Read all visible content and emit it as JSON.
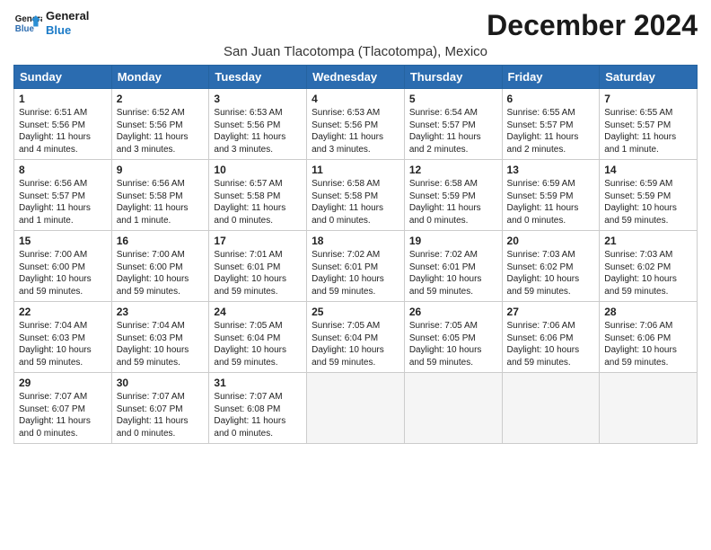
{
  "logo": {
    "line1": "General",
    "line2": "Blue"
  },
  "title": "December 2024",
  "subtitle": "San Juan Tlacotompa (Tlacotompa), Mexico",
  "days_header": [
    "Sunday",
    "Monday",
    "Tuesday",
    "Wednesday",
    "Thursday",
    "Friday",
    "Saturday"
  ],
  "weeks": [
    [
      {
        "day": "1",
        "sunrise": "6:51 AM",
        "sunset": "5:56 PM",
        "daylight": "11 hours and 4 minutes."
      },
      {
        "day": "2",
        "sunrise": "6:52 AM",
        "sunset": "5:56 PM",
        "daylight": "11 hours and 3 minutes."
      },
      {
        "day": "3",
        "sunrise": "6:53 AM",
        "sunset": "5:56 PM",
        "daylight": "11 hours and 3 minutes."
      },
      {
        "day": "4",
        "sunrise": "6:53 AM",
        "sunset": "5:56 PM",
        "daylight": "11 hours and 3 minutes."
      },
      {
        "day": "5",
        "sunrise": "6:54 AM",
        "sunset": "5:57 PM",
        "daylight": "11 hours and 2 minutes."
      },
      {
        "day": "6",
        "sunrise": "6:55 AM",
        "sunset": "5:57 PM",
        "daylight": "11 hours and 2 minutes."
      },
      {
        "day": "7",
        "sunrise": "6:55 AM",
        "sunset": "5:57 PM",
        "daylight": "11 hours and 1 minute."
      }
    ],
    [
      {
        "day": "8",
        "sunrise": "6:56 AM",
        "sunset": "5:57 PM",
        "daylight": "11 hours and 1 minute."
      },
      {
        "day": "9",
        "sunrise": "6:56 AM",
        "sunset": "5:58 PM",
        "daylight": "11 hours and 1 minute."
      },
      {
        "day": "10",
        "sunrise": "6:57 AM",
        "sunset": "5:58 PM",
        "daylight": "11 hours and 0 minutes."
      },
      {
        "day": "11",
        "sunrise": "6:58 AM",
        "sunset": "5:58 PM",
        "daylight": "11 hours and 0 minutes."
      },
      {
        "day": "12",
        "sunrise": "6:58 AM",
        "sunset": "5:59 PM",
        "daylight": "11 hours and 0 minutes."
      },
      {
        "day": "13",
        "sunrise": "6:59 AM",
        "sunset": "5:59 PM",
        "daylight": "11 hours and 0 minutes."
      },
      {
        "day": "14",
        "sunrise": "6:59 AM",
        "sunset": "5:59 PM",
        "daylight": "10 hours and 59 minutes."
      }
    ],
    [
      {
        "day": "15",
        "sunrise": "7:00 AM",
        "sunset": "6:00 PM",
        "daylight": "10 hours and 59 minutes."
      },
      {
        "day": "16",
        "sunrise": "7:00 AM",
        "sunset": "6:00 PM",
        "daylight": "10 hours and 59 minutes."
      },
      {
        "day": "17",
        "sunrise": "7:01 AM",
        "sunset": "6:01 PM",
        "daylight": "10 hours and 59 minutes."
      },
      {
        "day": "18",
        "sunrise": "7:02 AM",
        "sunset": "6:01 PM",
        "daylight": "10 hours and 59 minutes."
      },
      {
        "day": "19",
        "sunrise": "7:02 AM",
        "sunset": "6:01 PM",
        "daylight": "10 hours and 59 minutes."
      },
      {
        "day": "20",
        "sunrise": "7:03 AM",
        "sunset": "6:02 PM",
        "daylight": "10 hours and 59 minutes."
      },
      {
        "day": "21",
        "sunrise": "7:03 AM",
        "sunset": "6:02 PM",
        "daylight": "10 hours and 59 minutes."
      }
    ],
    [
      {
        "day": "22",
        "sunrise": "7:04 AM",
        "sunset": "6:03 PM",
        "daylight": "10 hours and 59 minutes."
      },
      {
        "day": "23",
        "sunrise": "7:04 AM",
        "sunset": "6:03 PM",
        "daylight": "10 hours and 59 minutes."
      },
      {
        "day": "24",
        "sunrise": "7:05 AM",
        "sunset": "6:04 PM",
        "daylight": "10 hours and 59 minutes."
      },
      {
        "day": "25",
        "sunrise": "7:05 AM",
        "sunset": "6:04 PM",
        "daylight": "10 hours and 59 minutes."
      },
      {
        "day": "26",
        "sunrise": "7:05 AM",
        "sunset": "6:05 PM",
        "daylight": "10 hours and 59 minutes."
      },
      {
        "day": "27",
        "sunrise": "7:06 AM",
        "sunset": "6:06 PM",
        "daylight": "10 hours and 59 minutes."
      },
      {
        "day": "28",
        "sunrise": "7:06 AM",
        "sunset": "6:06 PM",
        "daylight": "10 hours and 59 minutes."
      }
    ],
    [
      {
        "day": "29",
        "sunrise": "7:07 AM",
        "sunset": "6:07 PM",
        "daylight": "11 hours and 0 minutes."
      },
      {
        "day": "30",
        "sunrise": "7:07 AM",
        "sunset": "6:07 PM",
        "daylight": "11 hours and 0 minutes."
      },
      {
        "day": "31",
        "sunrise": "7:07 AM",
        "sunset": "6:08 PM",
        "daylight": "11 hours and 0 minutes."
      },
      null,
      null,
      null,
      null
    ]
  ]
}
